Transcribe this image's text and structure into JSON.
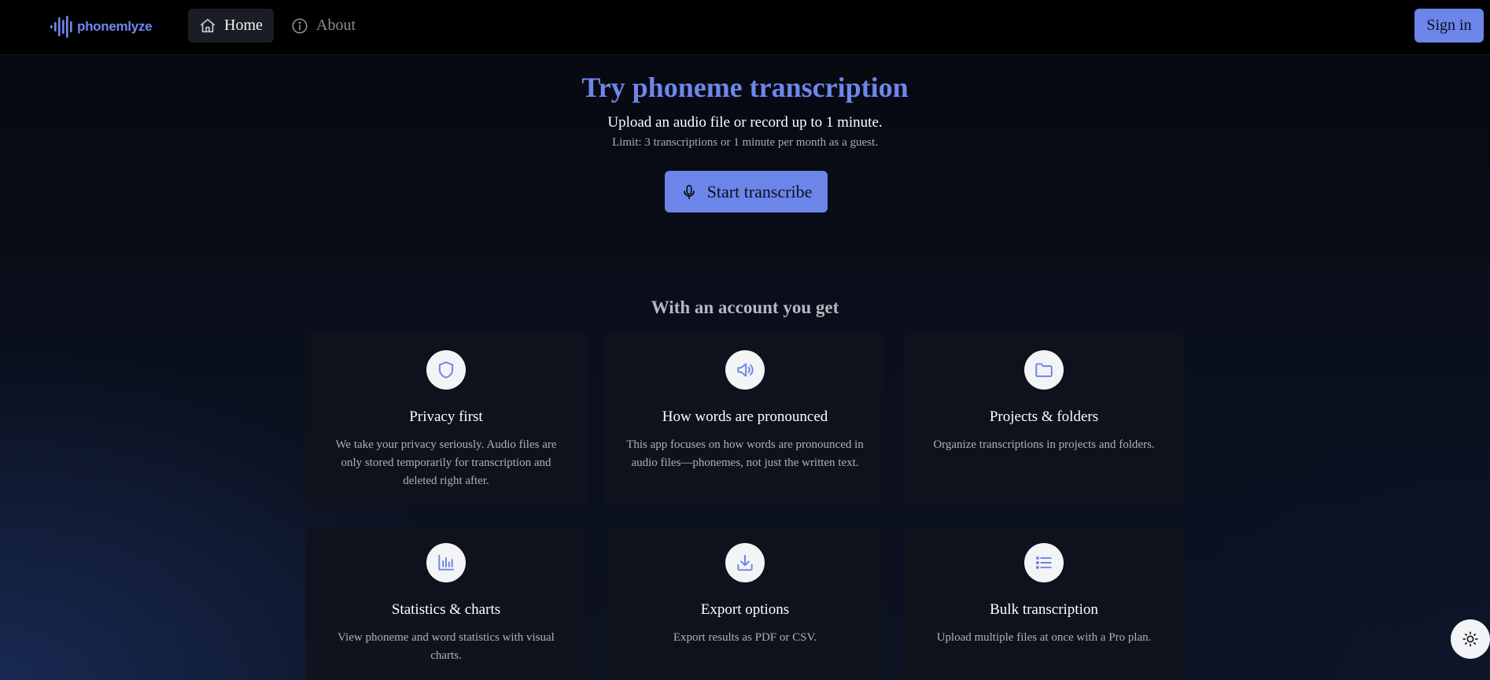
{
  "brand": {
    "name": "phonemlyze",
    "accent": "#6c85e8"
  },
  "nav": {
    "home": {
      "label": "Home",
      "icon": "home-icon",
      "active": true
    },
    "about": {
      "label": "About",
      "icon": "info-icon"
    },
    "signin_label": "Sign in"
  },
  "hero": {
    "title": "Try phoneme transcription",
    "subtitle": "Upload an audio file or record up to 1 minute.",
    "limit": "Limit: 3 transcriptions or 1 minute per month as a guest.",
    "button_label": "Start transcribe",
    "button_icon": "microphone-icon"
  },
  "features": {
    "heading": "With an account you get",
    "items": [
      {
        "icon": "shield-icon",
        "title": "Privacy first",
        "description": "We take your privacy seriously. Audio files are only stored temporarily for transcription and deleted right after."
      },
      {
        "icon": "speaker-icon",
        "title": "How words are pronounced",
        "description": "This app focuses on how words are pronounced in audio files—phonemes, not just the written text."
      },
      {
        "icon": "folder-icon",
        "title": "Projects & folders",
        "description": "Organize transcriptions in projects and folders."
      },
      {
        "icon": "bar-chart-icon",
        "title": "Statistics & charts",
        "description": "View phoneme and word statistics with visual charts."
      },
      {
        "icon": "download-icon",
        "title": "Export options",
        "description": "Export results as PDF or CSV."
      },
      {
        "icon": "list-icon",
        "title": "Bulk transcription",
        "description": "Upload multiple files at once with a Pro plan."
      }
    ]
  },
  "theme_toggle": {
    "icon": "sun-icon"
  }
}
